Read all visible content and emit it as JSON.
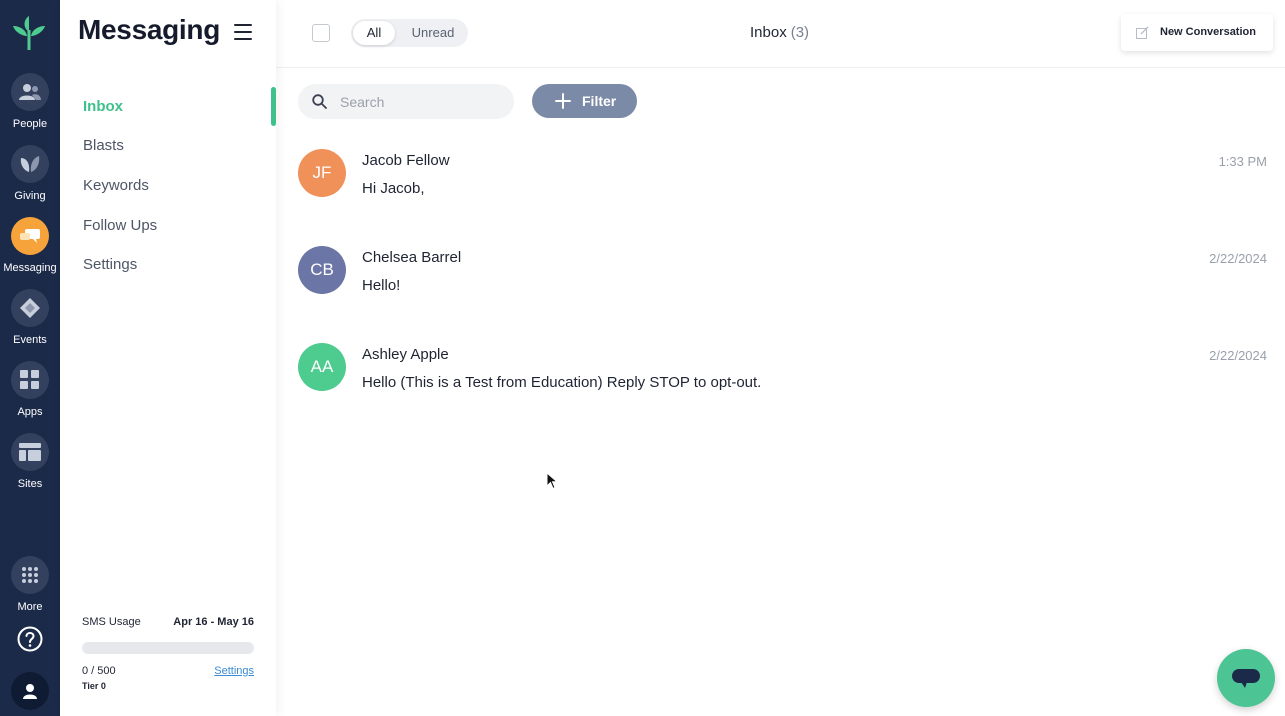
{
  "rail": {
    "items": [
      {
        "label": "People",
        "icon": "people-icon"
      },
      {
        "label": "Giving",
        "icon": "leaf-icon"
      },
      {
        "label": "Messaging",
        "icon": "chat-icon",
        "active": true
      },
      {
        "label": "Events",
        "icon": "ticket-icon"
      },
      {
        "label": "Apps",
        "icon": "grid-icon"
      },
      {
        "label": "Sites",
        "icon": "layout-icon"
      },
      {
        "label": "More",
        "icon": "dots-grid-icon"
      }
    ],
    "colors": {
      "background": "#1c2a4a",
      "active": "#f5a33a"
    }
  },
  "subnav": {
    "title": "Messaging",
    "items": [
      {
        "label": "Inbox",
        "active": true
      },
      {
        "label": "Blasts"
      },
      {
        "label": "Keywords"
      },
      {
        "label": "Follow Ups"
      },
      {
        "label": "Settings"
      }
    ],
    "sms": {
      "label": "SMS Usage",
      "range": "Apr 16 - May 16",
      "count": "0 / 500",
      "tier": "Tier 0",
      "settings_link": "Settings",
      "usage_fraction": 0
    }
  },
  "header": {
    "filter_all": "All",
    "filter_unread": "Unread",
    "inbox_label": "Inbox",
    "inbox_count": "(3)",
    "new_conversation": "New Conversation"
  },
  "toolbar": {
    "search_placeholder": "Search",
    "filter_label": "Filter"
  },
  "conversations": [
    {
      "initials": "JF",
      "name": "Jacob Fellow",
      "message": "Hi Jacob,",
      "time": "1:33 PM",
      "color": "#f0915a"
    },
    {
      "initials": "CB",
      "name": "Chelsea Barrel",
      "message": "Hello!",
      "time": "2/22/2024",
      "color": "#6b76a6"
    },
    {
      "initials": "AA",
      "name": "Ashley Apple",
      "message": "Hello (This is a Test from Education) Reply STOP to opt-out.",
      "time": "2/22/2024",
      "color": "#4ecb8e"
    }
  ],
  "accent_color": "#3ec18a"
}
